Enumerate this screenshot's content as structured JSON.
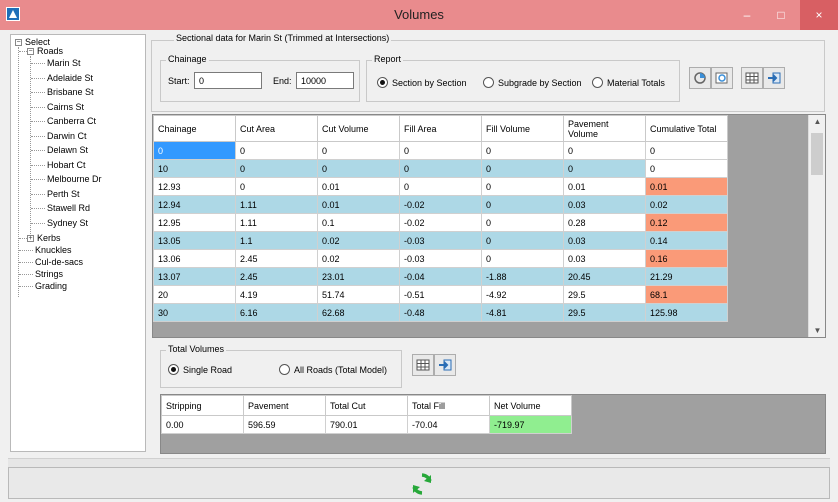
{
  "window": {
    "title": "Volumes",
    "controls": {
      "minimize": "–",
      "maximize": "□",
      "close": "×"
    }
  },
  "tree": {
    "root": "Select",
    "roads_label": "Roads",
    "roads": [
      "Marin St",
      "Adelaide St",
      "Brisbane St",
      "Cairns St",
      "Canberra Ct",
      "Darwin Ct",
      "Delawn St",
      "Hobart Ct",
      "Melbourne Dr",
      "Perth St",
      "Stawell Rd",
      "Sydney St"
    ],
    "others": [
      "Kerbs",
      "Knuckles",
      "Cul-de-sacs",
      "Strings",
      "Grading"
    ]
  },
  "section": {
    "title": "Sectional data for Marin St (Trimmed at Intersections)",
    "chainage": {
      "label": "Chainage",
      "start_label": "Start:",
      "start_value": "0",
      "end_label": "End:",
      "end_value": "10000"
    },
    "report": {
      "label": "Report",
      "options": [
        "Section by Section",
        "Subgrade by Section",
        "Material Totals"
      ],
      "selected": "Section by Section"
    },
    "icons": [
      "chart-icon",
      "chart-settings-icon",
      "table-icon",
      "export-icon"
    ]
  },
  "table": {
    "headers": [
      "Chainage",
      "Cut Area",
      "Cut Volume",
      "Fill Area",
      "Fill Volume",
      "Pavement Volume",
      "Cumulative Total"
    ],
    "rows": [
      [
        "0",
        "0",
        "0",
        "0",
        "0",
        "0",
        "0"
      ],
      [
        "10",
        "0",
        "0",
        "0",
        "0",
        "0",
        "0"
      ],
      [
        "12.93",
        "0",
        "0.01",
        "0",
        "0",
        "0.01",
        "0.01"
      ],
      [
        "12.94",
        "1.11",
        "0.01",
        "-0.02",
        "0",
        "0.03",
        "0.02"
      ],
      [
        "12.95",
        "1.11",
        "0.1",
        "-0.02",
        "0",
        "0.28",
        "0.12"
      ],
      [
        "13.05",
        "1.1",
        "0.02",
        "-0.03",
        "0",
        "0.03",
        "0.14"
      ],
      [
        "13.06",
        "2.45",
        "0.02",
        "-0.03",
        "0",
        "0.03",
        "0.16"
      ],
      [
        "13.07",
        "2.45",
        "23.01",
        "-0.04",
        "-1.88",
        "20.45",
        "21.29"
      ],
      [
        "20",
        "4.19",
        "51.74",
        "-0.51",
        "-4.92",
        "29.5",
        "68.1"
      ],
      [
        "30",
        "6.16",
        "62.68",
        "-0.48",
        "-4.81",
        "29.5",
        "125.98"
      ]
    ],
    "colors": {
      "alt_row": "#add8e6",
      "cumulative": "#fa9a78",
      "selected": "#3399ff"
    }
  },
  "totals": {
    "label": "Total Volumes",
    "options": [
      "Single Road",
      "All Roads (Total Model)"
    ],
    "selected": "Single Road",
    "headers": [
      "Stripping",
      "Pavement",
      "Total Cut",
      "Total Fill",
      "Net Volume"
    ],
    "values": [
      "0.00",
      "596.59",
      "790.01",
      "-70.04",
      "-719.97"
    ],
    "net_color": "#90ee90"
  },
  "footer": {
    "refresh_icon": "refresh-icon"
  }
}
